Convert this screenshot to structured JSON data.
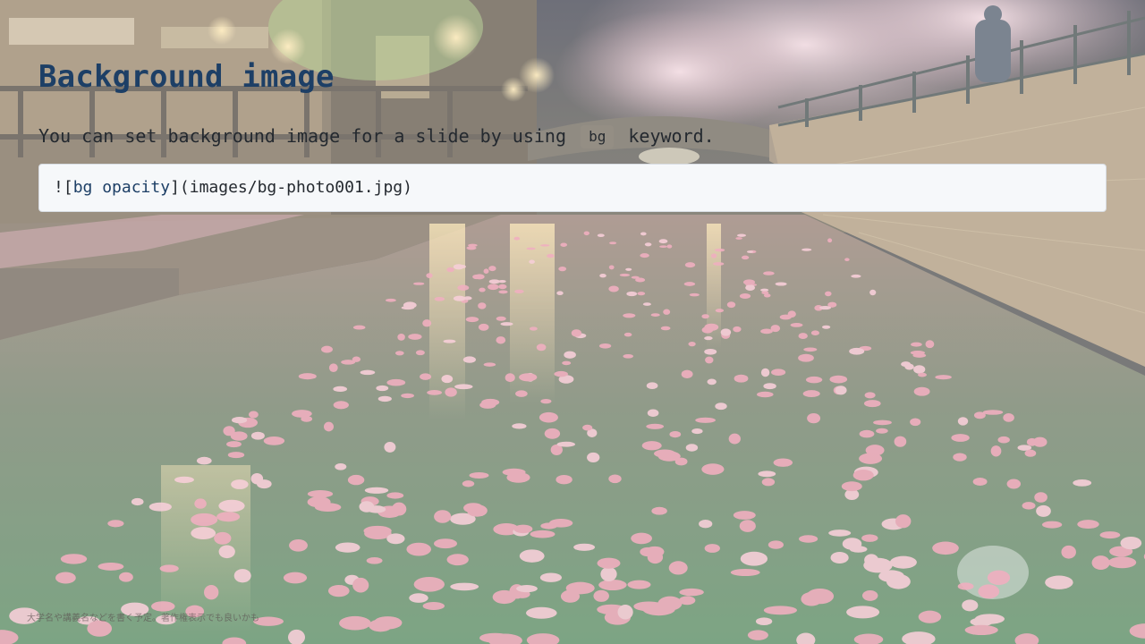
{
  "slide": {
    "title": "Background image",
    "body": {
      "text_before": "You can set background image for a slide by using ",
      "keyword": "bg",
      "text_after": " keyword."
    },
    "code_block": {
      "open": "![",
      "alt": "bg opacity",
      "close": "](images/bg-photo001.jpg)"
    },
    "footer": "大学名や講義名などを書く予定。著作権表示でも良いかも"
  },
  "background": {
    "icon": "cherry-blossom-canal-photo",
    "colors": {
      "blossom": "#e98aa2",
      "water": "#4f7a55",
      "wall": "#8d7a62",
      "night_sky": "#2a2c3a"
    }
  },
  "colors": {
    "title": "#1d3f66",
    "text": "#24292f",
    "code_bg": "#f6f8fa"
  }
}
